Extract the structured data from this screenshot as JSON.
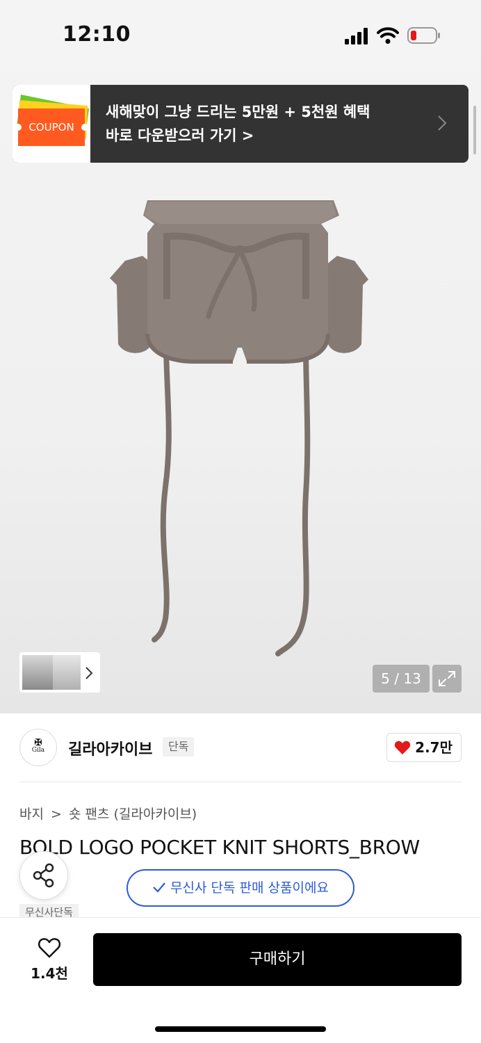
{
  "status_bar": {
    "time": "12:10"
  },
  "coupon_banner": {
    "coupon_label": "COUPON",
    "line1": "새해맞이 그냥 드리는 5만원 + 5천원 혜택",
    "line2": "바로 다운받으러 가기 >"
  },
  "gallery": {
    "counter": "5 / 13",
    "current": 5,
    "total": 13
  },
  "brand": {
    "logo_text": "Gila",
    "name": "길라아카이브",
    "badge": "단독",
    "like_count": "2.7만"
  },
  "breadcrumb": {
    "category": "바지",
    "separator": ">",
    "subcategory": "숏 팬츠 (길라아카이브)"
  },
  "product": {
    "title": "BOLD LOGO POCKET KNIT SHORTS_BROW",
    "exclusive_tag": "무신사단독"
  },
  "exclusive_notice": "무신사 단독 판매 상품이에요",
  "bottom_bar": {
    "wish_count": "1.4천",
    "buy_label": "구매하기"
  },
  "colors": {
    "accent_blue": "#2b5bd7",
    "heart_red": "#e3191a",
    "banner_bg": "#333333",
    "coupon_orange": "#ff5a1f"
  }
}
